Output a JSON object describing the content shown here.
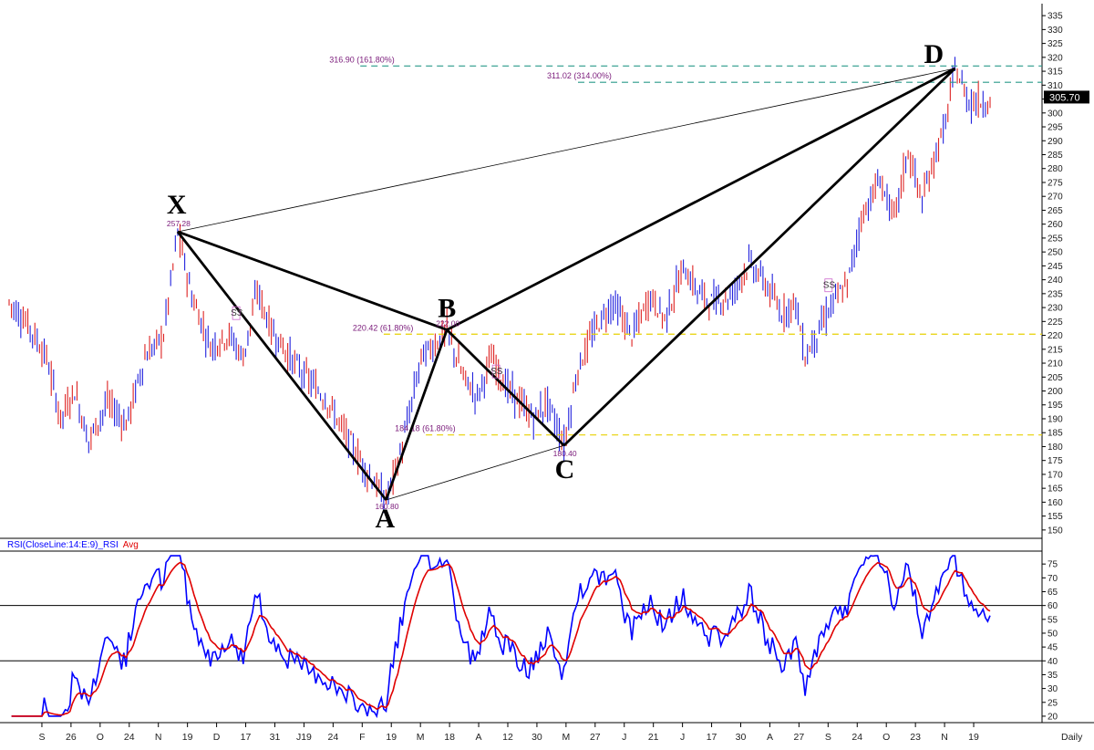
{
  "chart_data": [
    {
      "type": "line",
      "panel": "price",
      "frequency": "Daily",
      "ylim": [
        147,
        338
      ],
      "y_ticks": [
        150,
        155,
        160,
        165,
        170,
        175,
        180,
        185,
        190,
        195,
        200,
        205,
        210,
        215,
        220,
        225,
        230,
        235,
        240,
        245,
        250,
        255,
        260,
        265,
        270,
        275,
        280,
        285,
        290,
        295,
        300,
        305,
        310,
        315,
        320,
        325,
        330,
        335
      ],
      "last_price": "305.70",
      "pattern_points": [
        {
          "label": "X",
          "bar": 72,
          "price": 257.28,
          "value_text": "257.28"
        },
        {
          "label": "A",
          "bar": 161,
          "price": 160.8,
          "value_text": "160.80"
        },
        {
          "label": "B",
          "bar": 187,
          "price": 222.0,
          "value_text": "222.00"
        },
        {
          "label": "C",
          "bar": 237,
          "price": 180.4,
          "value_text": "180.40"
        },
        {
          "label": "D",
          "bar": 404,
          "price": 316.0,
          "value_text": ""
        }
      ],
      "fib_levels": [
        {
          "text": "316.90 (161.80%)",
          "price": 316.9,
          "color": "#2a9a8a",
          "from_bar": 150
        },
        {
          "text": "311.02 (314.00%)",
          "price": 311.02,
          "color": "#2a9a8a",
          "from_bar": 243
        },
        {
          "text": "220.42 (61.80%)",
          "price": 220.42,
          "color": "#e8d000",
          "from_bar": 160
        },
        {
          "text": "184.18 (61.80%)",
          "price": 184.18,
          "color": "#e8d000",
          "from_bar": 178
        }
      ],
      "signals": [
        {
          "text": "SS",
          "bar": 97,
          "price": 228
        },
        {
          "text": "SS",
          "bar": 208,
          "price": 207
        },
        {
          "text": "SS",
          "bar": 350,
          "price": 238
        }
      ],
      "x_ticks": [
        "S",
        "26",
        "O",
        "24",
        "N",
        "19",
        "D",
        "17",
        "31",
        "J19",
        "24",
        "F",
        "19",
        "M",
        "18",
        "A",
        "12",
        "30",
        "M",
        "27",
        "J",
        "21",
        "J",
        "17",
        "30",
        "A",
        "27",
        "S",
        "24",
        "O",
        "23",
        "N",
        "19"
      ],
      "x_unit": "Daily"
    },
    {
      "type": "line",
      "panel": "rsi",
      "title": "RSI(CloseLine:14:E:9)_RSI",
      "series": [
        {
          "name": "RSI(CloseLine:14:E:9)_RSI",
          "color": "#0000ff"
        },
        {
          "name": "Avg",
          "color": "#e00000"
        }
      ],
      "ylim": [
        18,
        80
      ],
      "y_ticks": [
        20,
        25,
        30,
        35,
        40,
        45,
        50,
        55,
        60,
        65,
        70,
        75
      ],
      "reference_lines": [
        40,
        60
      ]
    }
  ],
  "colors": {
    "up": "#2222dd",
    "down": "#dd2222",
    "pattern": "#000000",
    "rsi": "#0000ff",
    "rsi_avg": "#e00000"
  }
}
